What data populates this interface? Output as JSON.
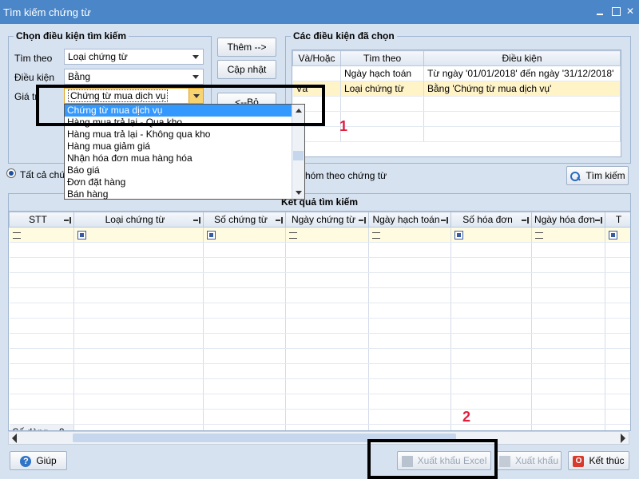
{
  "window": {
    "title": "Tìm kiếm chứng từ",
    "minimize": "",
    "maximize": "",
    "close": "✕"
  },
  "criteria": {
    "title": "Chọn điều kiện tìm kiếm",
    "find_by_label": "Tìm theo",
    "find_by_value": "Loại chứng từ",
    "condition_label": "Điều kiện",
    "condition_value": "Bằng",
    "value_label": "Giá trị",
    "value_value": "Chứng từ mua dịch vụ",
    "dropdown_options": [
      "Chứng từ mua dịch vụ",
      "Hàng mua trả lại - Qua kho",
      "Hàng mua trả lại - Không qua kho",
      "Hàng mua giảm giá",
      "Nhận hóa đơn mua hàng hóa",
      "Báo giá",
      "Đơn đặt hàng",
      "Bán hàng"
    ]
  },
  "buttons": {
    "add": "Thêm -->",
    "update": "Cập nhật",
    "remove": "<--Bỏ",
    "search": "Tìm kiếm",
    "help": "Giúp",
    "export_excel": "Xuất khẩu Excel",
    "export": "Xuất khẩu",
    "close": "Kết thúc"
  },
  "selected": {
    "title": "Các điều kiện đã chọn",
    "headers": [
      "Và/Hoặc",
      "Tìm theo",
      "Điều kiện"
    ],
    "rows": [
      [
        "",
        "Ngày hạch toán",
        "Từ ngày '01/01/2018' đến ngày '31/12/2018'"
      ],
      [
        "Và",
        "Loại chứng từ",
        "Bằng 'Chứng từ mua dịch vụ'"
      ]
    ]
  },
  "options": {
    "all_label": "Tất cả chứng",
    "group_label": "hóm theo chứng từ"
  },
  "results": {
    "title": "Kết quả tìm kiếm",
    "headers": [
      "STT",
      "Loại chứng từ",
      "Số chứng từ",
      "Ngày chứng từ",
      "Ngày hạch toán",
      "Số hóa đơn",
      "Ngày hóa đơn",
      "T"
    ],
    "row_count": "Số dòng = 0"
  },
  "annotations": {
    "one": "1",
    "two": "2"
  }
}
